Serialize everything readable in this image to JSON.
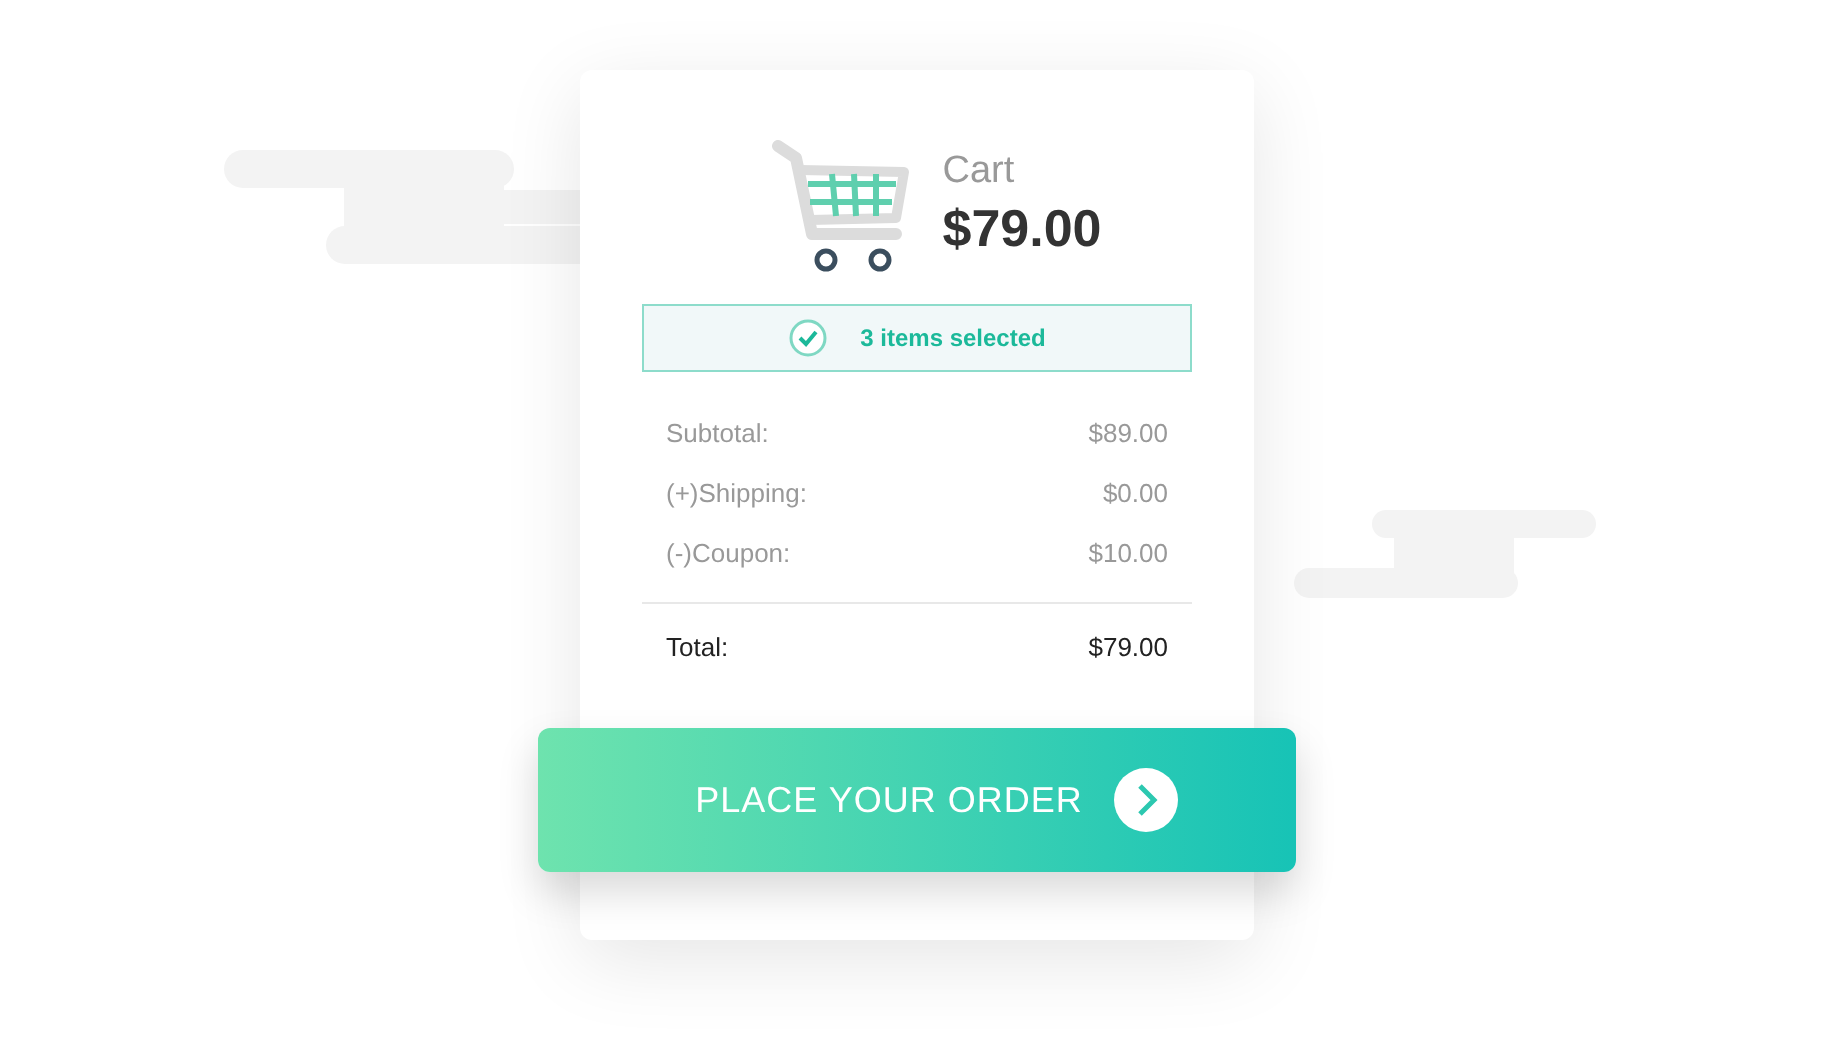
{
  "cart": {
    "title": "Cart",
    "amount": "$79.00"
  },
  "selection": {
    "text": "3 items selected",
    "checked": true
  },
  "summary": [
    {
      "kind": "line",
      "label": "Subtotal:",
      "value": "$89.00"
    },
    {
      "kind": "line",
      "label": "(+)Shipping:",
      "value": "$0.00"
    },
    {
      "kind": "line",
      "label": "(-)Coupon:",
      "value": "$10.00"
    },
    {
      "kind": "total",
      "label": "Total:",
      "value": "$79.00"
    }
  ],
  "button": {
    "label": "PLACE YOUR ORDER"
  }
}
